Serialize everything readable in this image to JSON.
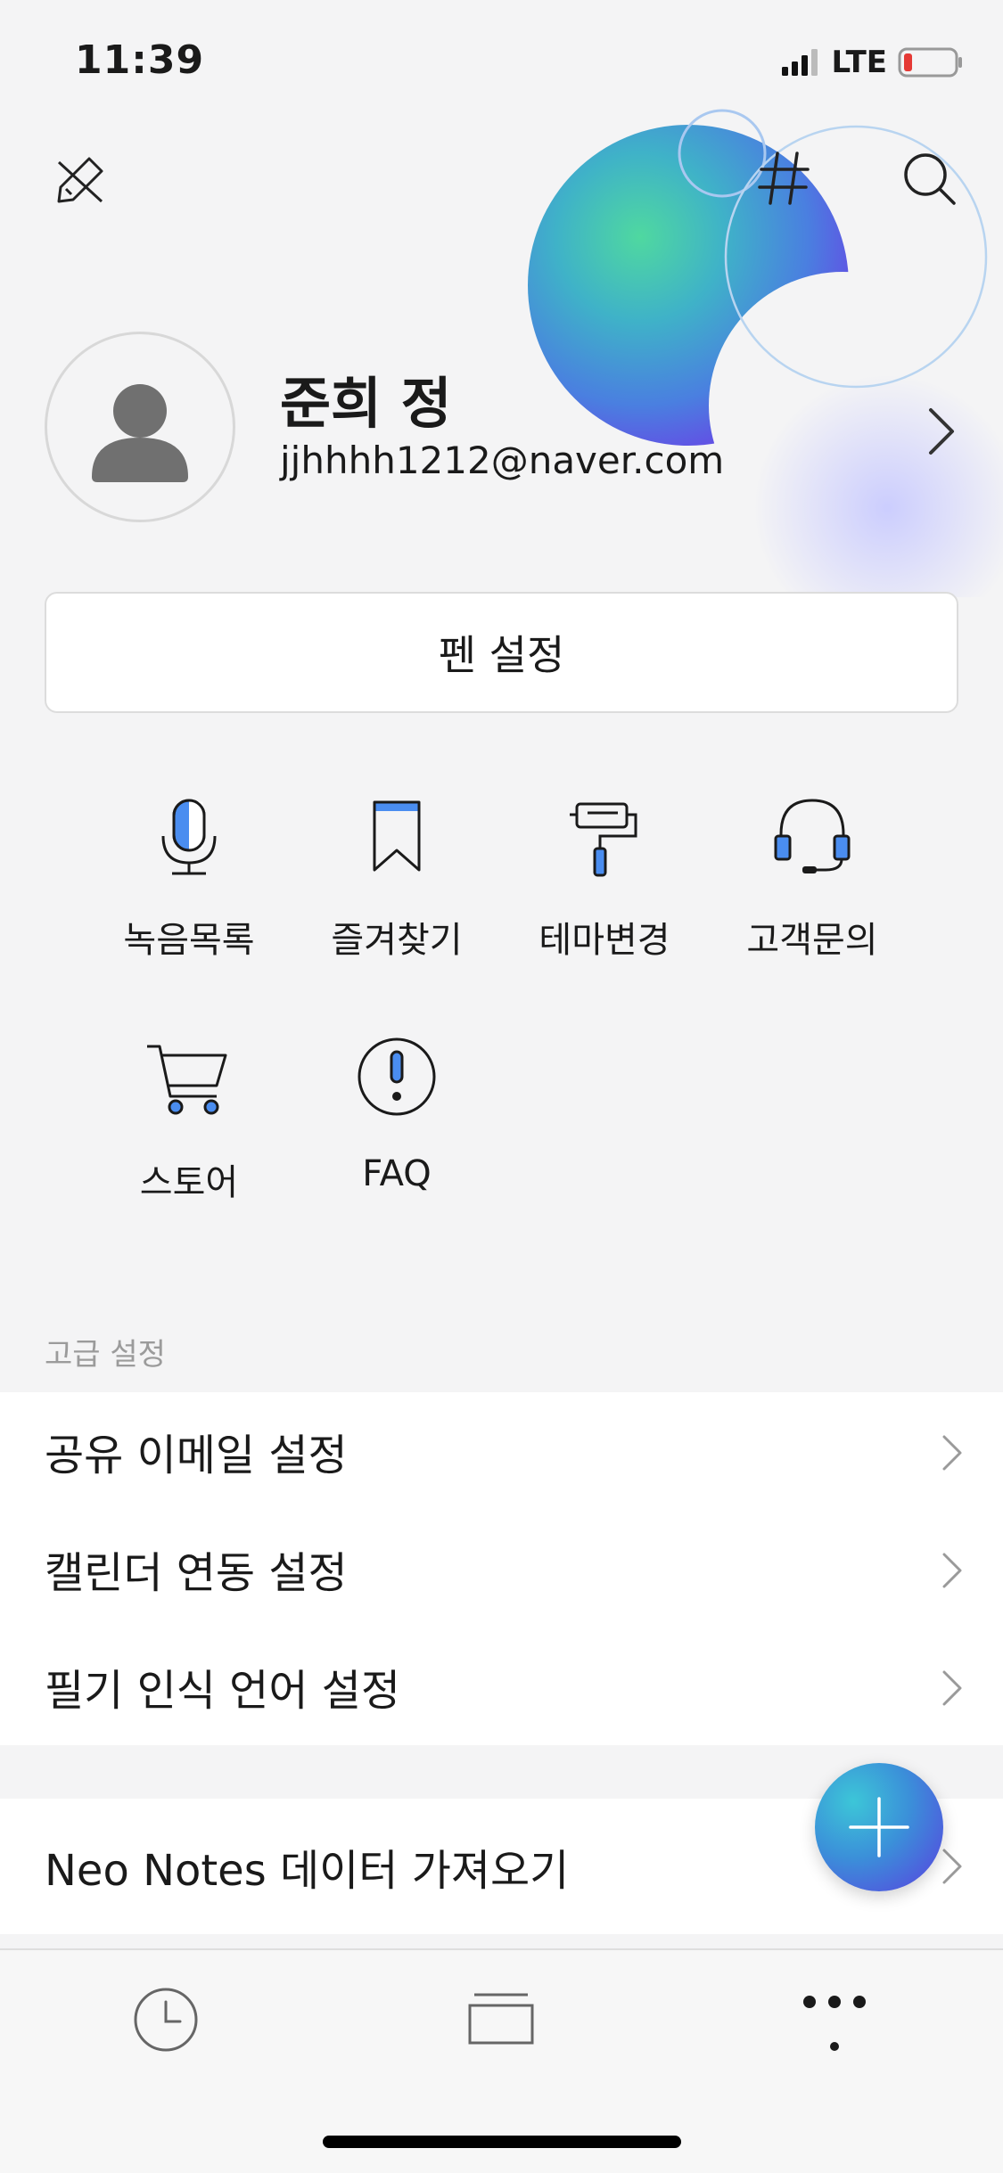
{
  "status_bar": {
    "time": "11:39",
    "network": "LTE"
  },
  "header": {
    "pen_icon": "pen-off-icon",
    "hashtag_icon": "hashtag-icon",
    "search_icon": "search-icon"
  },
  "profile": {
    "name": "준희 정",
    "email": "jjhhhh1212@naver.com"
  },
  "pen_settings_label": "펜 설정",
  "quick_menu": [
    {
      "label": "녹음목록",
      "icon": "microphone-icon"
    },
    {
      "label": "즐겨찾기",
      "icon": "bookmark-icon"
    },
    {
      "label": "테마변경",
      "icon": "paint-roller-icon"
    },
    {
      "label": "고객문의",
      "icon": "headset-icon"
    },
    {
      "label": "스토어",
      "icon": "cart-icon"
    },
    {
      "label": "FAQ",
      "icon": "exclamation-icon"
    }
  ],
  "advanced": {
    "title": "고급 설정",
    "items": [
      {
        "label": "공유 이메일 설정"
      },
      {
        "label": "캘린더 연동 설정"
      },
      {
        "label": "필기 인식 언어 설정"
      }
    ]
  },
  "import_label": "Neo Notes 데이터 가져오기",
  "tabbar": {
    "tabs": [
      {
        "icon": "clock-icon"
      },
      {
        "icon": "notebook-icon"
      },
      {
        "icon": "more-icon"
      }
    ]
  },
  "colors": {
    "accent": "#4a8df0",
    "fab_gradient": [
      "#3cc6d8",
      "#5a3ee0"
    ]
  }
}
